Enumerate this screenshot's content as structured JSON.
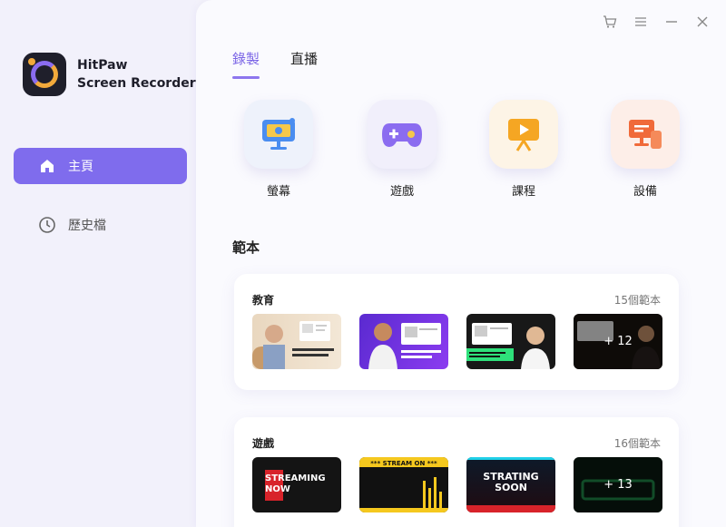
{
  "app": {
    "name_line1": "HitPaw",
    "name_line2": "Screen Recorder"
  },
  "sidebar": {
    "items": [
      {
        "label": "主頁",
        "icon": "home-icon",
        "active": true
      },
      {
        "label": "歷史檔",
        "icon": "clock-icon",
        "active": false
      }
    ]
  },
  "window_controls": [
    "cart-icon",
    "menu-icon",
    "minimize-icon",
    "close-icon"
  ],
  "tabs": [
    {
      "label": "錄製",
      "active": true
    },
    {
      "label": "直播",
      "active": false
    }
  ],
  "modes": [
    {
      "label": "螢幕",
      "icon": "monitor-icon"
    },
    {
      "label": "遊戲",
      "icon": "gamepad-icon"
    },
    {
      "label": "課程",
      "icon": "presentation-icon"
    },
    {
      "label": "設備",
      "icon": "device-icon"
    }
  ],
  "templates": {
    "title": "範本",
    "categories": [
      {
        "name": "教育",
        "count": "15個範本",
        "more": "+ 12",
        "thumb_captions": [
          "",
          "",
          "",
          ""
        ]
      },
      {
        "name": "遊戲",
        "count": "16個範本",
        "more": "+ 13",
        "thumb_captions": [
          "STREAMING NOW",
          "*** STREAM ON ***",
          "STRATING SOON",
          ""
        ]
      }
    ]
  },
  "colors": {
    "accent": "#7f6ced",
    "sidebar_bg": "#f2f1fb",
    "main_bg": "#fafafe"
  }
}
